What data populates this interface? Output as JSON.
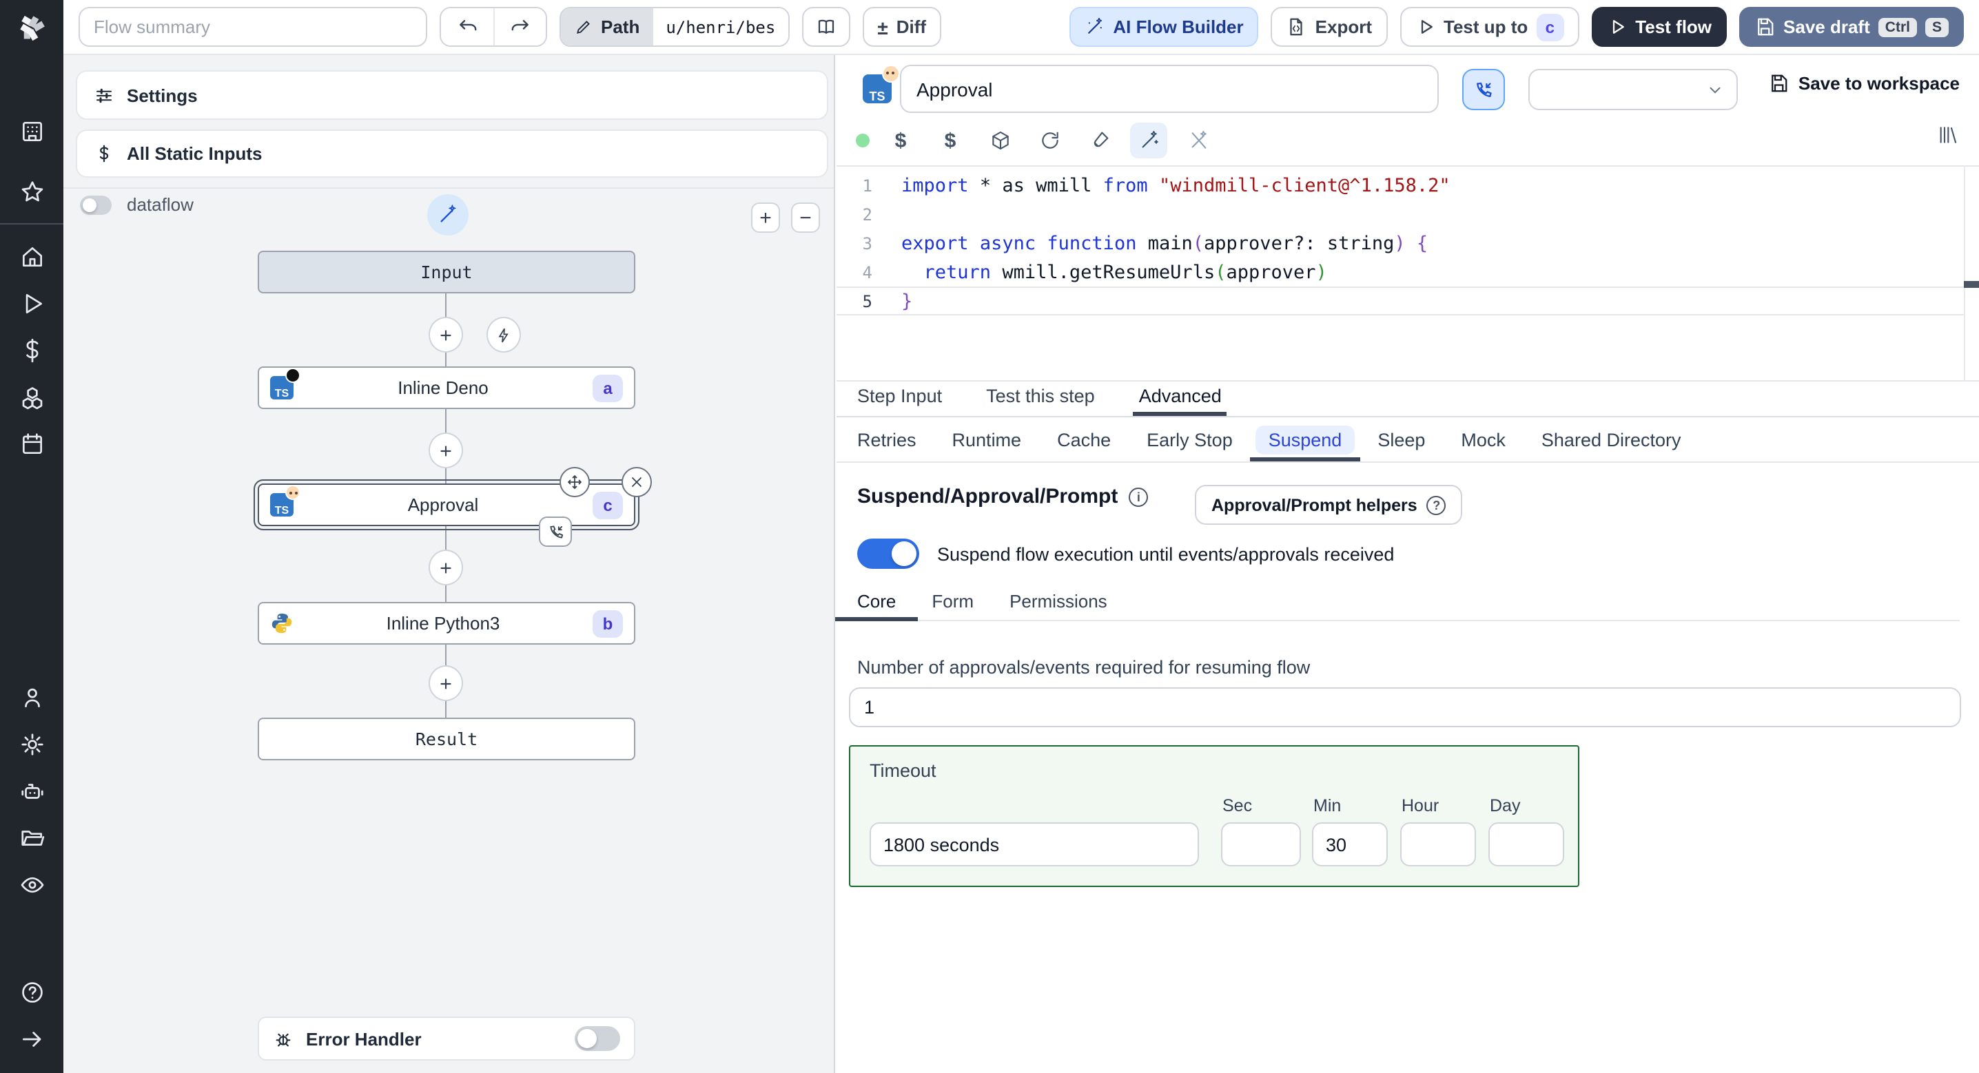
{
  "topbar": {
    "flow_summary_placeholder": "Flow summary",
    "path_label": "Path",
    "path_value": "u/henri/bes",
    "diff_label": "Diff",
    "diff_sign": "±",
    "ai_flow_builder_label": "AI Flow Builder",
    "export_label": "Export",
    "test_up_to_label": "Test up to",
    "test_up_to_step": "c",
    "test_flow_label": "Test flow",
    "save_draft_label": "Save draft",
    "kbd_ctrl": "Ctrl",
    "kbd_s": "S"
  },
  "sidebar": {
    "icons": [
      "windmill-logo",
      "workspace",
      "favorites",
      "home",
      "runs",
      "variables",
      "resources",
      "schedules",
      "users",
      "settings",
      "workers",
      "folders",
      "audit-logs",
      "help",
      "expand"
    ]
  },
  "flow": {
    "settings": "Settings",
    "all_static_inputs": "All Static Inputs",
    "dataflow": "dataflow",
    "zoom_in": "+",
    "zoom_out": "−",
    "nodes": {
      "input": "Input",
      "deno_label": "Inline Deno",
      "deno_badge": "a",
      "approval_label": "Approval",
      "approval_badge": "c",
      "python_label": "Inline Python3",
      "python_badge": "b",
      "result": "Result",
      "ts_chip": "TS"
    },
    "error_handler": "Error Handler"
  },
  "editor": {
    "step_name_value": "Approval",
    "save_to_workspace": "Save to workspace",
    "line_numbers": [
      "1",
      "2",
      "3",
      "4",
      "5"
    ],
    "code": {
      "l1": {
        "t0": "import",
        "t1": " * as wmill ",
        "t2": "from",
        "t3": " ",
        "t4": "\"windmill-client@^1.158.2\""
      },
      "l3": {
        "t0": "export",
        "t1": " ",
        "t2": "async",
        "t3": " ",
        "t4": "function",
        "t5": " main",
        "t6": "(",
        "t7": "approver?: string",
        "t8": ")",
        "t9": " {"
      },
      "l4": {
        "t0": "  ",
        "t1": "return",
        "t2": " wmill.getResumeUrls",
        "t3": "(",
        "t4": "approver",
        "t5": ")"
      },
      "l5": {
        "t0": "}"
      }
    }
  },
  "tabs": {
    "main": [
      "Step Input",
      "Test this step",
      "Advanced"
    ],
    "advanced": [
      "Retries",
      "Runtime",
      "Cache",
      "Early Stop",
      "Suspend",
      "Sleep",
      "Mock",
      "Shared Directory"
    ],
    "inner": [
      "Core",
      "Form",
      "Permissions"
    ]
  },
  "suspend": {
    "heading": "Suspend/Approval/Prompt",
    "helpers_button": "Approval/Prompt helpers",
    "toggle_label": "Suspend flow execution until events/approvals received",
    "approvals_label": "Number of approvals/events required for resuming flow",
    "approvals_value": "1",
    "timeout_label": "Timeout",
    "timeout_value": "1800 seconds",
    "unit_sec": "Sec",
    "unit_min": "Min",
    "unit_hour": "Hour",
    "unit_day": "Day",
    "sec_value": "",
    "min_value": "30",
    "hour_value": "",
    "day_value": ""
  },
  "colors": {
    "accent_blue": "#2f6fe4",
    "active_tab_underline": "#3c4656",
    "suspend_tab_text": "#2b46d4",
    "badge_bg": "#e0e7ff",
    "badge_text": "#4338ca",
    "timeout_border": "#19692f",
    "dark_button": "#272e3d",
    "save_draft_button": "#5f7296"
  }
}
